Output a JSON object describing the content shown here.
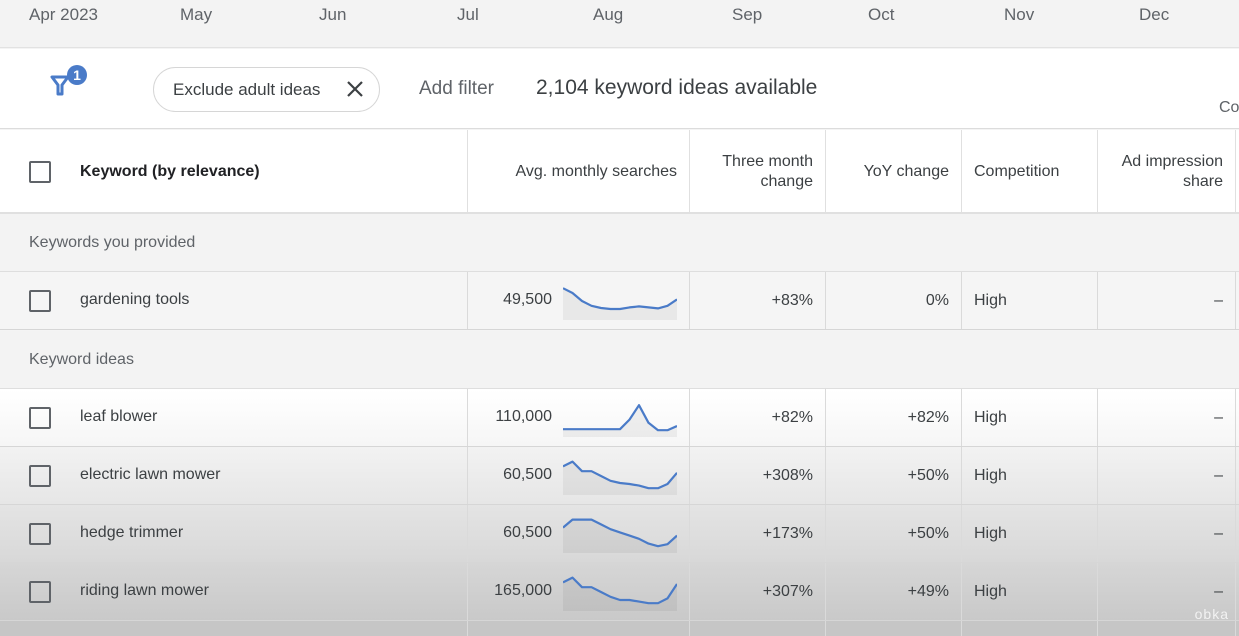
{
  "timeline": {
    "months": [
      "Apr 2023",
      "May",
      "Jun",
      "Jul",
      "Aug",
      "Sep",
      "Oct",
      "Nov",
      "Dec"
    ]
  },
  "filters": {
    "filter_badge_count": "1",
    "active_chip": "Exclude adult ideas",
    "add_filter_label": "Add filter",
    "ideas_count": "2,104 keyword ideas available",
    "cut_off_label": "Co"
  },
  "table": {
    "headers": {
      "keyword": "Keyword (by relevance)",
      "avg_searches": "Avg. monthly searches",
      "three_month": "Three month change",
      "yoy": "YoY change",
      "competition": "Competition",
      "ad_impression": "Ad impression share"
    },
    "groups": [
      {
        "label": "Keywords you provided",
        "rows": [
          {
            "keyword": "gardening tools",
            "avg_searches": "49,500",
            "three_month": "+83%",
            "yoy": "0%",
            "competition": "High",
            "ad_impression": "–",
            "trend": [
              0.9,
              0.75,
              0.5,
              0.35,
              0.28,
              0.25,
              0.25,
              0.3,
              0.33,
              0.3,
              0.27,
              0.35,
              0.55
            ]
          }
        ]
      },
      {
        "label": "Keyword ideas",
        "rows": [
          {
            "keyword": "leaf blower",
            "avg_searches": "110,000",
            "three_month": "+82%",
            "yoy": "+82%",
            "competition": "High",
            "ad_impression": "–",
            "trend": [
              0.15,
              0.15,
              0.15,
              0.15,
              0.15,
              0.15,
              0.15,
              0.45,
              0.9,
              0.35,
              0.12,
              0.12,
              0.25
            ]
          },
          {
            "keyword": "electric lawn mower",
            "avg_searches": "60,500",
            "three_month": "+308%",
            "yoy": "+50%",
            "competition": "High",
            "ad_impression": "–",
            "trend": [
              0.8,
              0.95,
              0.65,
              0.65,
              0.5,
              0.35,
              0.28,
              0.25,
              0.2,
              0.12,
              0.12,
              0.25,
              0.6
            ]
          },
          {
            "keyword": "hedge trimmer",
            "avg_searches": "60,500",
            "three_month": "+173%",
            "yoy": "+50%",
            "competition": "High",
            "ad_impression": "–",
            "trend": [
              0.7,
              0.95,
              0.95,
              0.95,
              0.8,
              0.65,
              0.55,
              0.45,
              0.35,
              0.2,
              0.12,
              0.18,
              0.45
            ]
          },
          {
            "keyword": "riding lawn mower",
            "avg_searches": "165,000",
            "three_month": "+307%",
            "yoy": "+49%",
            "competition": "High",
            "ad_impression": "–",
            "trend": [
              0.8,
              0.95,
              0.65,
              0.65,
              0.5,
              0.35,
              0.25,
              0.25,
              0.2,
              0.15,
              0.15,
              0.3,
              0.75
            ]
          }
        ]
      }
    ]
  },
  "colors": {
    "accent": "#4a7bc8",
    "spark_fill": "#e8e8e8"
  },
  "watermark": "obka"
}
